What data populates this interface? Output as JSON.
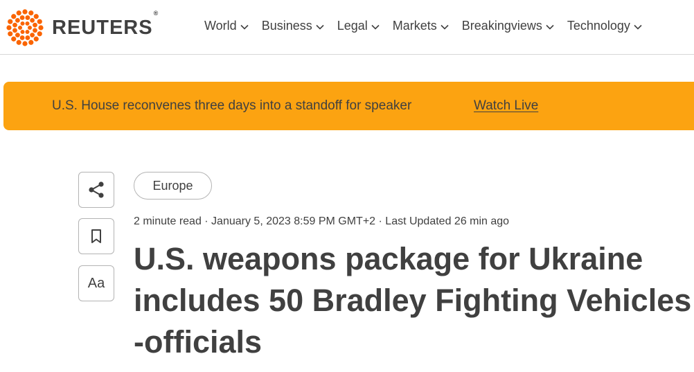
{
  "brand": {
    "name": "REUTERS",
    "reg": "®"
  },
  "nav": {
    "items": [
      {
        "label": "World"
      },
      {
        "label": "Business"
      },
      {
        "label": "Legal"
      },
      {
        "label": "Markets"
      },
      {
        "label": "Breakingviews"
      },
      {
        "label": "Technology"
      }
    ]
  },
  "banner": {
    "text": "U.S. House reconvenes three days into a standoff for speaker",
    "link": "Watch Live"
  },
  "tools": {
    "font_size_label": "Aa"
  },
  "article": {
    "tag": "Europe",
    "meta": "2 minute read · January 5, 2023 8:59 PM GMT+2 · Last Updated 26 min ago",
    "headline": "U.S. weapons package for Ukraine includes 50 Bradley Fighting Vehicles -officials"
  },
  "colors": {
    "accent": "#fca311",
    "logo_orange": "#fa6400",
    "text": "#404040"
  }
}
